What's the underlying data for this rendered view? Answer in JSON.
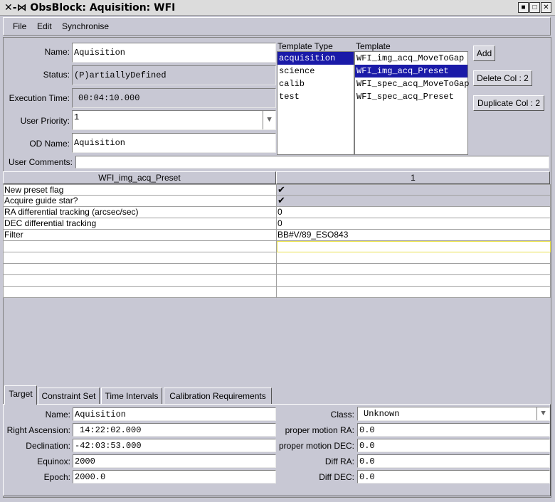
{
  "window": {
    "title": "ObsBlock: Aquisition: WFI",
    "btn_min": "■",
    "btn_max": "□",
    "btn_close": "✕"
  },
  "menu": {
    "file": "File",
    "edit": "Edit",
    "sync": "Synchronise"
  },
  "form": {
    "name_label": "Name:",
    "name_value": "Aquisition",
    "status_label": "Status:",
    "status_value": "(P)artiallyDefined",
    "exec_label": "Execution Time:",
    "exec_value": "00:04:10.000",
    "priority_label": "User Priority:",
    "priority_value": "1",
    "odname_label": "OD Name:",
    "odname_value": "Aquisition",
    "comments_label": "User Comments:",
    "comments_value": ""
  },
  "template_type": {
    "header": "Template Type",
    "items": [
      "acquisition",
      "science",
      "calib",
      "test"
    ],
    "selected": 0
  },
  "template": {
    "header": "Template",
    "items": [
      "WFI_img_acq_MoveToGap",
      "WFI_img_acq_Preset",
      "WFI_spec_acq_MoveToGap",
      "WFI_spec_acq_Preset"
    ],
    "selected": 1
  },
  "buttons": {
    "add": "Add",
    "delete": "Delete Col : 2",
    "duplicate": "Duplicate Col : 2"
  },
  "table": {
    "col1_header": "WFI_img_acq_Preset",
    "col2_header": "1",
    "rows": [
      {
        "param": "New preset flag",
        "value": "✔"
      },
      {
        "param": "Acquire guide star?",
        "value": "✔"
      },
      {
        "param": "RA differential tracking (arcsec/sec)",
        "value": "0"
      },
      {
        "param": "DEC differential tracking",
        "value": "0"
      },
      {
        "param": "Filter",
        "value": "BB#V/89_ESO843"
      }
    ]
  },
  "tabs": [
    "Target",
    "Constraint Set",
    "Time Intervals",
    "Calibration Requirements"
  ],
  "target": {
    "name_label": "Name:",
    "name_value": "Aquisition",
    "ra_label": "Right Ascension:",
    "ra_value": "14:22:02.000",
    "dec_label": "Declination:",
    "dec_value": "-42:03:53.000",
    "equinox_label": "Equinox:",
    "equinox_value": "2000",
    "epoch_label": "Epoch:",
    "epoch_value": "2000.0",
    "class_label": "Class:",
    "class_value": "Unknown",
    "pmra_label": "proper motion RA:",
    "pmra_value": "0.0",
    "pmdec_label": "proper motion DEC:",
    "pmdec_value": "0.0",
    "diffra_label": "Diff RA:",
    "diffra_value": "0.0",
    "diffdec_label": "Diff DEC:",
    "diffdec_value": "0.0"
  }
}
